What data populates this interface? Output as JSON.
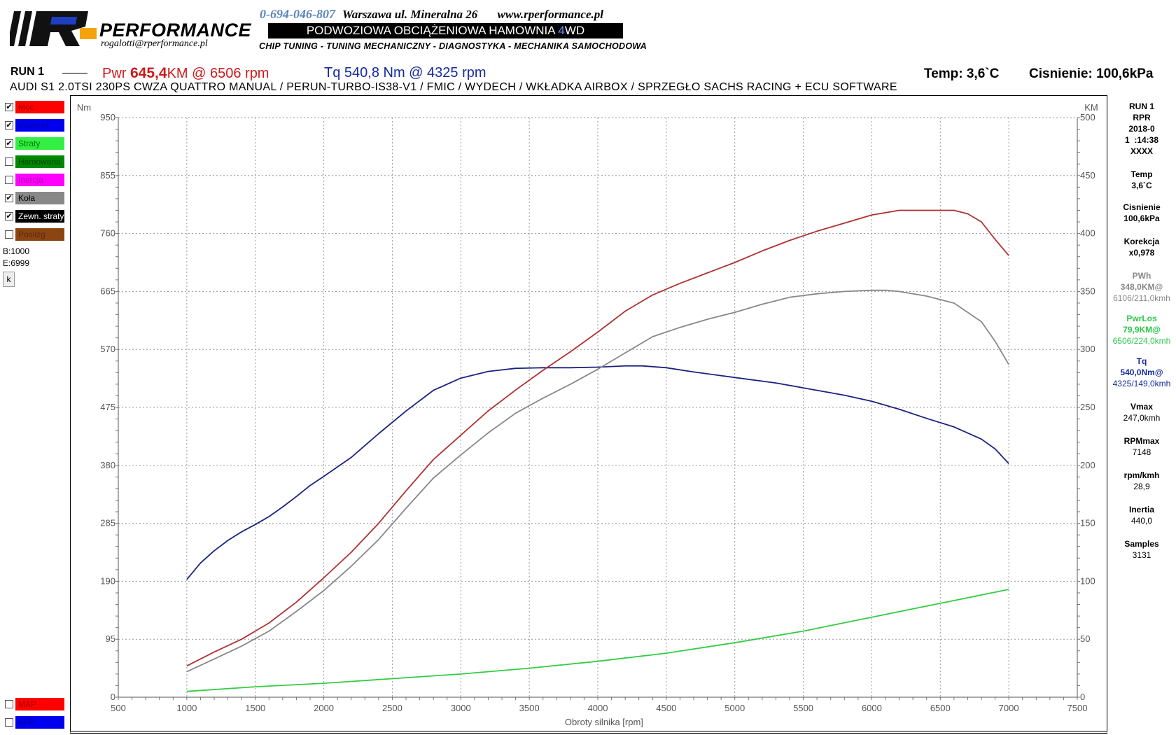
{
  "header": {
    "logo_text": "PERFORMANCE",
    "logo_email": "rogalotti@rperformance.pl",
    "phone": "0-694-046-807",
    "address": "Warszawa ul. Mineralna 26",
    "website": "www.rperformance.pl",
    "banner_pre": "PODWOZIOWA OBCIĄŻENIOWA HAMOWNIA ",
    "banner_hl": "4",
    "banner_post": "WD",
    "services": "CHIP TUNING - TUNING MECHANICZNY - DIAGNOSTYKA - MECHANIKA SAMOCHODOWA",
    "colors": {
      "banner_bg": "#000000",
      "phone": "#5a86b8"
    }
  },
  "run": {
    "label": "RUN 1",
    "pwr_prefix": "Pwr ",
    "pwr_value": "645,4",
    "pwr_suffix": "KM @ 6506 rpm",
    "tq_text": "Tq 540,8 Nm @ 4325 rpm",
    "temp": "Temp: 3,6`C",
    "pressure": "Cisnienie: 100,6kPa",
    "car": "AUDI S1 2.0TSI 230PS CWZA QUATTRO MANUAL / PERUN-TURBO-IS38-V1 / FMIC / WYDECH / WKŁADKA AIRBOX / SPRZEGŁO SACHS RACING + ECU SOFTWARE"
  },
  "legend": [
    {
      "label": "Moc",
      "checked": true,
      "color": "#ff0000",
      "text_color": "#a00000"
    },
    {
      "label": "Moment",
      "checked": true,
      "color": "#0000ee",
      "text_color": "#0000aa"
    },
    {
      "label": "Straty",
      "checked": true,
      "color": "#33ee44",
      "text_color": "#007700"
    },
    {
      "label": "Hamowana",
      "checked": false,
      "color": "#008800",
      "text_color": "#004400"
    },
    {
      "label": "Inercja",
      "checked": false,
      "color": "#ff00ff",
      "text_color": "#aa00aa"
    },
    {
      "label": "Koła",
      "checked": true,
      "color": "#888888",
      "text_color": "#000000"
    },
    {
      "label": "Zewn. straty",
      "checked": true,
      "color": "#000000",
      "text_color": "#ffffff"
    },
    {
      "label": "Poslizg",
      "checked": false,
      "color": "#8b4513",
      "text_color": "#5a2a08"
    }
  ],
  "legend_bottom": [
    {
      "label": "MAP",
      "checked": false,
      "color": "#ff0000",
      "text_color": "#a00000"
    },
    {
      "label": "AFR",
      "checked": false,
      "color": "#0000ee",
      "text_color": "#0000aa"
    }
  ],
  "range": {
    "b": "B:1000",
    "e": "E:6999",
    "button": "k"
  },
  "info": {
    "run": "RUN 1",
    "code": "RPR",
    "date": "2018-0",
    "time": "1  :14:38",
    "xxxx": "XXXX",
    "temp_label": "Temp",
    "temp_value": "3,6`C",
    "press_label": "Cisnienie",
    "press_value": "100,6kPa",
    "korekcja_label": "Korekcja",
    "korekcja_value": "x0,978",
    "pwh_label": "PWh",
    "pwh_value": "348,0KM@",
    "pwh_at": "6106/211,0kmh",
    "pwrlos_label": "PwrLos",
    "pwrlos_value": "79,9KM@",
    "pwrlos_at": "6506/224,0kmh",
    "tq_label": "Tq",
    "tq_value": "540,0Nm@",
    "tq_at": "4325/149,0kmh",
    "vmax_label": "Vmax",
    "vmax_value": "247,0kmh",
    "rpmmax_label": "RPMmax",
    "rpmmax_value": "7148",
    "rpmkmh_label": "rpm/kmh",
    "rpmkmh_value": "28,9",
    "inertia_label": "Inertia",
    "inertia_value": "440,0",
    "samples_label": "Samples",
    "samples_value": "3131"
  },
  "chart_data": {
    "type": "line",
    "xlabel": "Obroty silnika [rpm]",
    "ylabel_left": "Nm",
    "ylabel_right": "KM",
    "xlim": [
      500,
      7500
    ],
    "ylim_left": [
      0,
      950
    ],
    "ylim_right": [
      0,
      500
    ],
    "xticks": [
      500,
      1000,
      1500,
      2000,
      2500,
      3000,
      3500,
      4000,
      4500,
      5000,
      5500,
      6000,
      6500,
      7000,
      7500
    ],
    "yticks_left": [
      0,
      95,
      190,
      285,
      380,
      475,
      570,
      665,
      760,
      855,
      950
    ],
    "yticks_right": [
      0,
      50,
      100,
      150,
      200,
      250,
      300,
      350,
      400,
      450,
      500
    ],
    "grid": true,
    "series": [
      {
        "color": "#1a237e",
        "axis": "left",
        "x": [
          1000,
          1100,
          1200,
          1300,
          1400,
          1500,
          1600,
          1700,
          1800,
          1900,
          2000,
          2200,
          2400,
          2600,
          2800,
          3000,
          3200,
          3400,
          3600,
          3800,
          4000,
          4200,
          4325,
          4500,
          4700,
          5000,
          5300,
          5500,
          5800,
          6000,
          6200,
          6400,
          6600,
          6800,
          6900,
          7000
        ],
        "values": [
          193,
          220,
          240,
          257,
          271,
          283,
          296,
          312,
          329,
          347,
          362,
          393,
          432,
          469,
          503,
          523,
          534,
          539,
          540,
          540,
          541,
          543,
          543,
          540,
          533,
          524,
          515,
          507,
          495,
          485,
          472,
          457,
          443,
          423,
          407,
          383
        ]
      },
      {
        "color": "#b03030",
        "axis": "right",
        "x": [
          1000,
          1200,
          1400,
          1600,
          1800,
          2000,
          2200,
          2400,
          2600,
          2800,
          3000,
          3200,
          3400,
          3600,
          3800,
          4000,
          4200,
          4400,
          4600,
          4800,
          5000,
          5200,
          5400,
          5600,
          5800,
          6000,
          6200,
          6400,
          6500,
          6600,
          6700,
          6800,
          6900,
          7000
        ],
        "values": [
          27,
          39,
          50,
          64,
          82,
          103,
          125,
          150,
          178,
          205,
          226,
          247,
          265,
          282,
          298,
          315,
          333,
          347,
          357,
          366,
          375,
          385,
          394,
          402,
          409,
          416,
          420,
          420,
          420,
          420,
          417,
          410,
          395,
          381
        ]
      },
      {
        "color": "#888888",
        "axis": "right",
        "x": [
          1000,
          1200,
          1400,
          1600,
          1800,
          2000,
          2200,
          2400,
          2600,
          2800,
          3000,
          3200,
          3400,
          3600,
          3800,
          4000,
          4200,
          4400,
          4600,
          4800,
          5000,
          5200,
          5400,
          5600,
          5800,
          6000,
          6106,
          6200,
          6400,
          6600,
          6800,
          6900,
          7000
        ],
        "values": [
          22,
          33,
          44,
          57,
          74,
          92,
          113,
          136,
          163,
          189,
          209,
          228,
          245,
          258,
          270,
          283,
          297,
          311,
          319,
          326,
          332,
          339,
          345,
          348,
          350,
          351,
          351,
          350,
          346,
          340,
          324,
          307,
          287
        ]
      },
      {
        "color": "#33cc44",
        "axis": "right",
        "x": [
          1000,
          1500,
          2000,
          2500,
          3000,
          3500,
          4000,
          4500,
          5000,
          5500,
          6000,
          6500,
          7000
        ],
        "values": [
          5,
          9,
          12,
          16,
          20,
          25,
          31,
          38,
          47,
          57,
          69,
          81,
          93
        ]
      }
    ]
  }
}
